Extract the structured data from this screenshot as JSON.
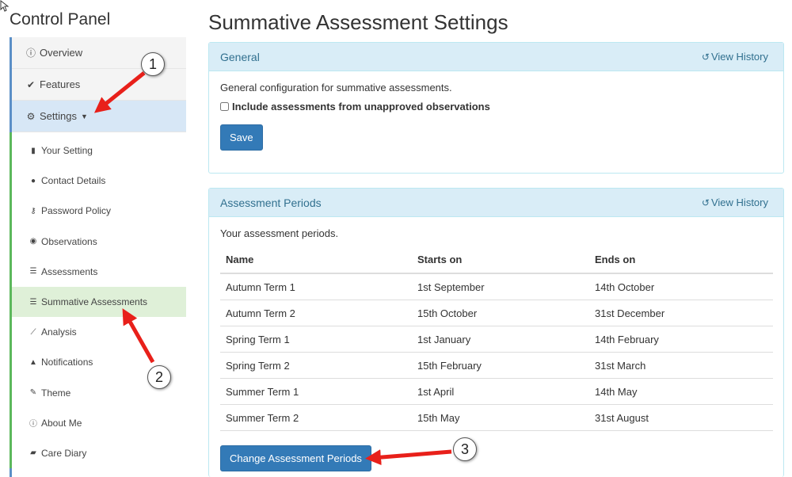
{
  "sidebar": {
    "title": "Control Panel",
    "top_items": [
      {
        "label": "Overview",
        "icon": "info-circle-icon"
      },
      {
        "label": "Features",
        "icon": "check-icon"
      },
      {
        "label": "Settings",
        "icon": "gear-icon",
        "active": true
      }
    ],
    "sub_items": [
      {
        "label": "Your Setting",
        "icon": "building-icon"
      },
      {
        "label": "Contact Details",
        "icon": "chat-bubble-icon"
      },
      {
        "label": "Password Policy",
        "icon": "key-icon"
      },
      {
        "label": "Observations",
        "icon": "eye-icon"
      },
      {
        "label": "Assessments",
        "icon": "list-icon"
      },
      {
        "label": "Summative Assessments",
        "icon": "list-icon",
        "active": true
      },
      {
        "label": "Analysis",
        "icon": "line-chart-icon"
      },
      {
        "label": "Notifications",
        "icon": "bell-icon"
      },
      {
        "label": "Theme",
        "icon": "brush-icon"
      },
      {
        "label": "About Me",
        "icon": "info-circle-icon"
      },
      {
        "label": "Care Diary",
        "icon": "book-icon"
      }
    ]
  },
  "main": {
    "title": "Summative Assessment Settings",
    "general": {
      "heading": "General",
      "view_history": "View History",
      "description": "General configuration for summative assessments.",
      "checkbox_label": "Include assessments from unapproved observations",
      "checkbox_checked": false,
      "save_label": "Save"
    },
    "periods": {
      "heading": "Assessment Periods",
      "view_history": "View History",
      "description": "Your assessment periods.",
      "columns": [
        "Name",
        "Starts on",
        "Ends on"
      ],
      "rows": [
        [
          "Autumn Term 1",
          "1st September",
          "14th October"
        ],
        [
          "Autumn Term 2",
          "15th October",
          "31st December"
        ],
        [
          "Spring Term 1",
          "1st January",
          "14th February"
        ],
        [
          "Spring Term 2",
          "15th February",
          "31st March"
        ],
        [
          "Summer Term 1",
          "1st April",
          "14th May"
        ],
        [
          "Summer Term 2",
          "15th May",
          "31st August"
        ]
      ],
      "change_label": "Change Assessment Periods"
    }
  },
  "annotations": [
    "1",
    "2",
    "3"
  ],
  "colors": {
    "accent": "#337ab7",
    "panel_heading": "#d9edf7",
    "active_sub": "#dff0d8",
    "arrow": "#e8201a"
  }
}
